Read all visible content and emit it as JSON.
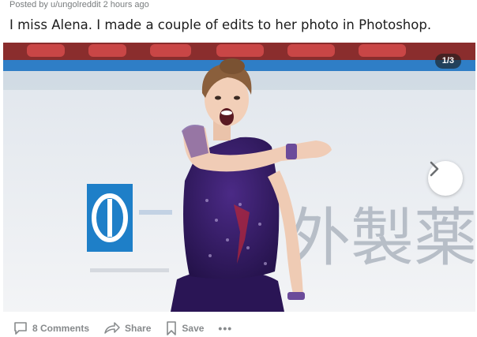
{
  "post": {
    "meta": "Posted by u/ungolreddit 2 hours ago",
    "title": "I miss Alena. I made a couple of edits to her photo in Photoshop."
  },
  "media": {
    "counter": "1/3",
    "next_icon": "chevron-right-icon",
    "background_sign_text": "外製薬",
    "colors": {
      "dress": "#3a1f6b",
      "rink_board": "#f2f4f7",
      "banner": "#c53434",
      "sign_blue": "#1e7fc8"
    }
  },
  "actions": {
    "comments": "8 Comments",
    "share": "Share",
    "save": "Save",
    "more": "•••"
  }
}
